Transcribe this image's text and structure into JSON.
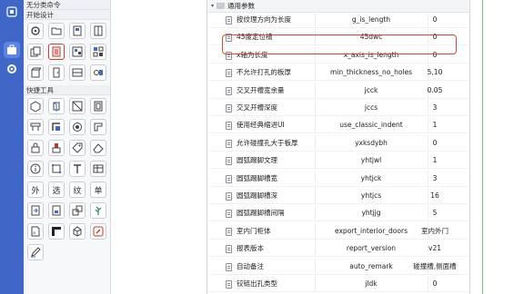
{
  "toolbox": {
    "section_unclassified": "无分类命令",
    "section_start_design": "开始设计",
    "section_quick_tools": "快捷工具",
    "char_tools": [
      "外",
      "选",
      "纹",
      "单"
    ]
  },
  "props": {
    "group_label": "通用参数",
    "rows": [
      {
        "name": "按纹理方向为长度",
        "var": "g_is_length",
        "val": "0"
      },
      {
        "name": "45度定位槽",
        "var": "45dwc",
        "val": "0"
      },
      {
        "name": "x轴为长度",
        "var": "x_axis_is_length",
        "val": "0"
      },
      {
        "name": "不允许打孔的板厚",
        "var": "min_thickness_no_holes",
        "val": "5,10"
      },
      {
        "name": "交叉开槽宽余量",
        "var": "jcck",
        "val": "0.05"
      },
      {
        "name": "交叉开槽深度",
        "var": "jccs",
        "val": "3"
      },
      {
        "name": "使用经典缩进UI",
        "var": "use_classic_indent",
        "val": "1"
      },
      {
        "name": "允许碰撞孔大于板厚",
        "var": "yxksdybh",
        "val": "0"
      },
      {
        "name": "圆弧踢脚文理",
        "var": "yhtjwl",
        "val": "1"
      },
      {
        "name": "圆弧踢脚槽宽",
        "var": "yhtjck",
        "val": "3"
      },
      {
        "name": "圆弧踢脚槽深",
        "var": "yhtjcs",
        "val": "16"
      },
      {
        "name": "圆弧踢脚槽间隔",
        "var": "yhtjjg",
        "val": "5"
      },
      {
        "name": "室内门柜体",
        "var": "export_interior_doors",
        "val": "室内外门"
      },
      {
        "name": "报表版本",
        "var": "report_version",
        "val": "v21"
      },
      {
        "name": "自动备注",
        "var": "auto_remark",
        "val": "碰撞槽,侧面槽"
      },
      {
        "name": "铰链出孔类型",
        "var": "jldk",
        "val": "0"
      }
    ]
  },
  "colors": {
    "rail": "#3e67c8",
    "highlight": "#d84a3a",
    "canvas_guide": "#6ccf6c"
  }
}
